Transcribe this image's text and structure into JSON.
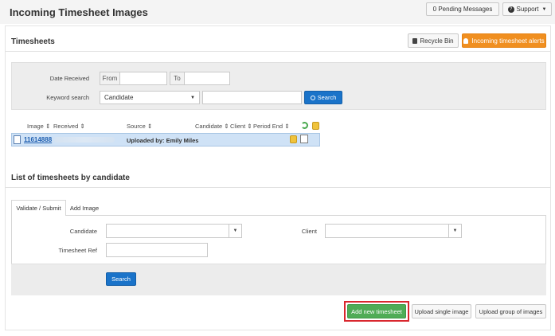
{
  "header": {
    "title": "Incoming Timesheet Images",
    "pending_messages": "0 Pending Messages",
    "support": "Support"
  },
  "timesheets": {
    "title": "Timesheets",
    "recycle_bin": "Recycle Bin",
    "alerts": "Incoming timesheet alerts",
    "filters": {
      "date_received_label": "Date Received",
      "from": "From",
      "to": "To",
      "keyword_label": "Keyword search",
      "keyword_select": "Candidate",
      "search_button": "Search"
    },
    "columns": [
      "Image",
      "Received",
      "Source",
      "Candidate",
      "Client",
      "Period End"
    ],
    "rows": [
      {
        "image": "11614888",
        "source": "Uploaded by: Emily Miles"
      }
    ]
  },
  "candidate_list": {
    "title": "List of timesheets by candidate",
    "tabs": [
      "Validate / Submit",
      "Add Image"
    ],
    "candidate_label": "Candidate",
    "client_label": "Client",
    "timesheet_ref_label": "Timesheet Ref",
    "search_button": "Search"
  },
  "actions": {
    "add_new": "Add new timesheet",
    "upload_single": "Upload single image",
    "upload_group": "Upload group of images"
  },
  "colors": {
    "accent_blue": "#1a73c9",
    "alert_orange": "#f08f20",
    "success_green": "#4fac56",
    "highlight_red": "#d9272e"
  }
}
